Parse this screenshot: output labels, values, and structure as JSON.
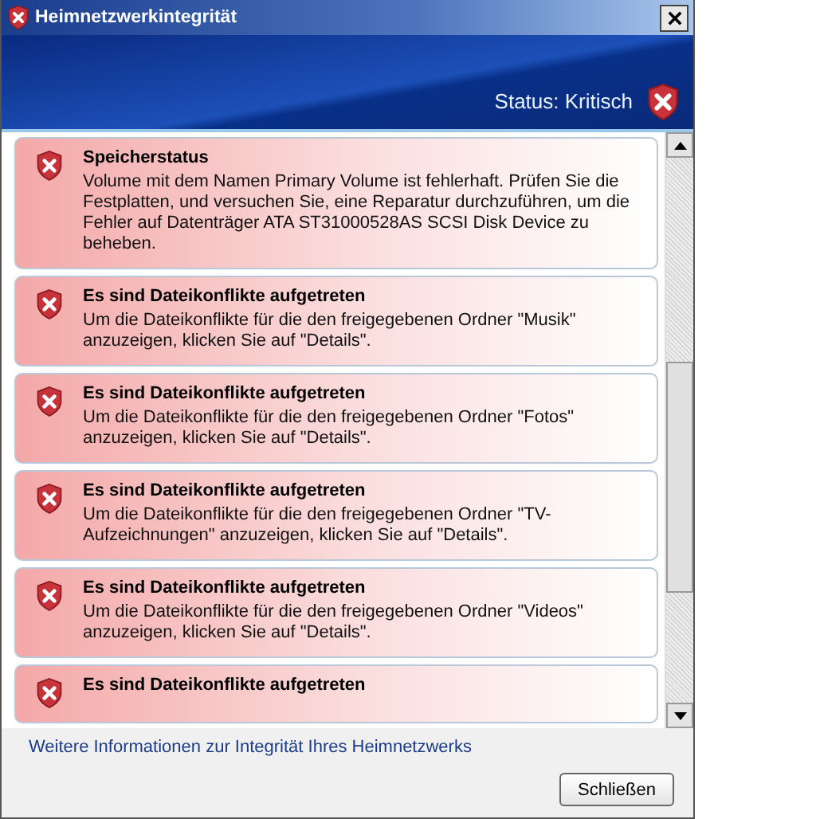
{
  "window": {
    "title": "Heimnetzwerkintegrität"
  },
  "header": {
    "status": "Status: Kritisch"
  },
  "issues": [
    {
      "title": "Speicherstatus",
      "text": "Volume mit dem Namen Primary Volume ist fehlerhaft. Prüfen Sie die Festplatten, und versuchen Sie, eine Reparatur durchzuführen, um die Fehler auf Datenträger ATA ST31000528AS SCSI Disk Device zu beheben."
    },
    {
      "title": "Es sind Dateikonflikte aufgetreten",
      "text": "Um die Dateikonflikte für die den freigegebenen Ordner \"Musik\" anzuzeigen, klicken Sie auf \"Details\"."
    },
    {
      "title": "Es sind Dateikonflikte aufgetreten",
      "text": "Um die Dateikonflikte für die den freigegebenen Ordner \"Fotos\" anzuzeigen, klicken Sie auf \"Details\"."
    },
    {
      "title": "Es sind Dateikonflikte aufgetreten",
      "text": "Um die Dateikonflikte für die den freigegebenen Ordner \"TV-Aufzeichnungen\" anzuzeigen, klicken Sie auf \"Details\"."
    },
    {
      "title": "Es sind Dateikonflikte aufgetreten",
      "text": "Um die Dateikonflikte für die den freigegebenen Ordner \"Videos\" anzuzeigen, klicken Sie auf \"Details\"."
    },
    {
      "title": "Es sind Dateikonflikte aufgetreten"
    }
  ],
  "footer": {
    "link": "Weitere Informationen zur Integrität Ihres Heimnetzwerks",
    "button": "Schließen"
  }
}
